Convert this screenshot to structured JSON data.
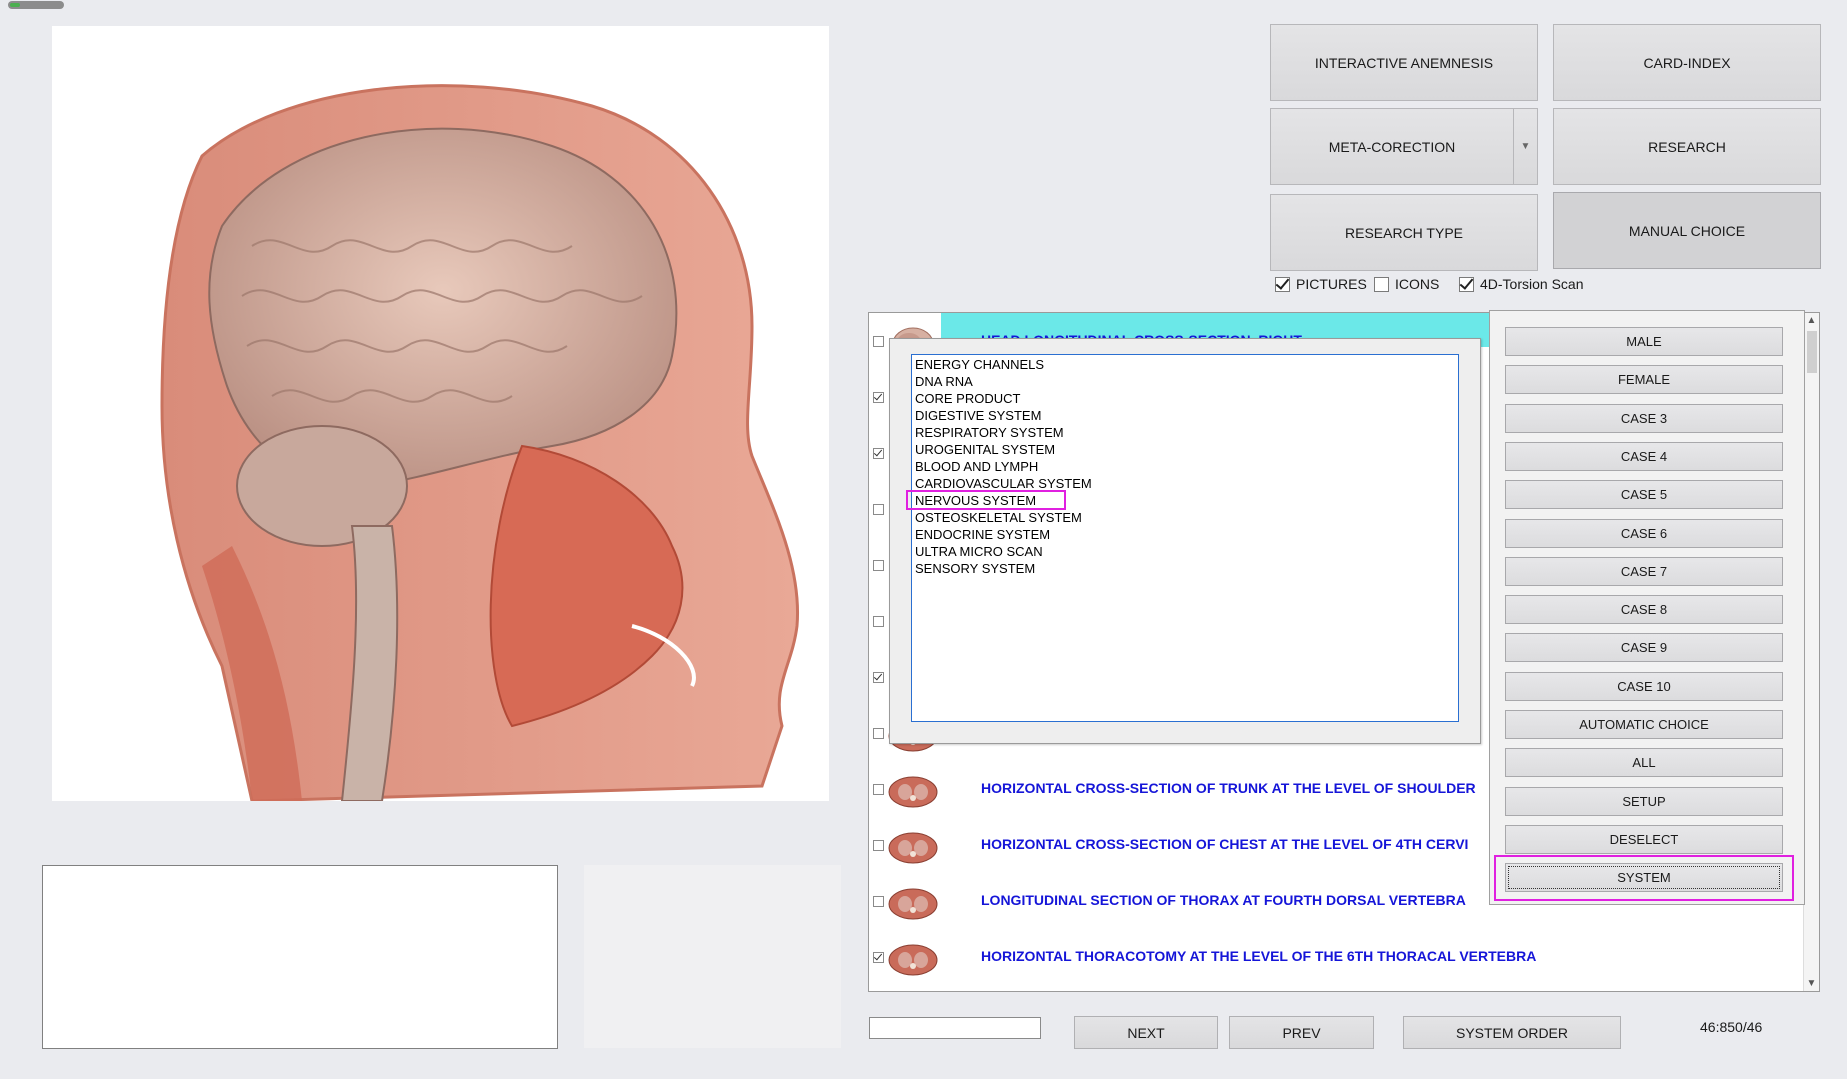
{
  "progress": {
    "level": 0.2
  },
  "buttons": {
    "interactive_anemnesis": "INTERACTIVE ANEMNESIS",
    "card_index": "CARD-INDEX",
    "meta_corection": "META-CORECTION",
    "research": "RESEARCH",
    "research_type": "RESEARCH TYPE",
    "manual_choice": "MANUAL CHOICE"
  },
  "options": {
    "pictures": {
      "label": "PICTURES",
      "checked": true
    },
    "icons": {
      "label": "ICONS",
      "checked": false
    },
    "torsion": {
      "label": "4D-Torsion Scan",
      "checked": true
    }
  },
  "list": {
    "rows": [
      {
        "text": "HEAD LONGITUDINAL CROSS-SECTION. RIGHT",
        "checked": false,
        "thumb": "head-thumb"
      },
      {
        "text": "",
        "checked": true,
        "thumb": "none"
      },
      {
        "text": "",
        "checked": true,
        "thumb": "none"
      },
      {
        "text": "",
        "checked": false,
        "thumb": "none"
      },
      {
        "text": "",
        "checked": false,
        "thumb": "none"
      },
      {
        "text": "",
        "checked": false,
        "thumb": "none"
      },
      {
        "text": "",
        "checked": true,
        "thumb": "none"
      },
      {
        "text": "",
        "checked": false,
        "thumb": "section-thumb"
      },
      {
        "text": "HORIZONTAL CROSS-SECTION OF TRUNK AT THE LEVEL OF SHOULDER",
        "checked": false,
        "thumb": "section-thumb"
      },
      {
        "text": "HORIZONTAL CROSS-SECTION OF CHEST AT THE LEVEL OF 4TH CERVI",
        "checked": false,
        "thumb": "section-thumb"
      },
      {
        "text": "LONGITUDINAL SECTION OF THORAX AT FOURTH DORSAL VERTEBRA",
        "checked": false,
        "thumb": "section-thumb"
      },
      {
        "text": "HORIZONTAL THORACOTOMY AT THE LEVEL OF THE 6TH THORACAL VERTEBRA",
        "checked": true,
        "thumb": "section-thumb"
      }
    ]
  },
  "system_popup": {
    "items": [
      "ENERGY CHANNELS",
      "DNA RNA",
      "CORE PRODUCT",
      "DIGESTIVE SYSTEM",
      "RESPIRATORY SYSTEM",
      "UROGENITAL SYSTEM",
      "BLOOD AND LYMPH",
      "CARDIOVASCULAR SYSTEM",
      "NERVOUS SYSTEM",
      "OSTEOSKELETAL SYSTEM",
      "ENDOCRINE SYSTEM",
      "ULTRA MICRO SCAN",
      "SENSORY SYSTEM"
    ],
    "highlighted": "NERVOUS SYSTEM"
  },
  "case_panel": {
    "buttons": [
      "MALE",
      "FEMALE",
      "CASE 3",
      "CASE 4",
      "CASE 5",
      "CASE 6",
      "CASE 7",
      "CASE 8",
      "CASE 9",
      "CASE 10",
      "AUTOMATIC CHOICE",
      "ALL",
      "SETUP",
      "DESELECT",
      "SYSTEM"
    ],
    "highlighted": "SYSTEM"
  },
  "bottom": {
    "page_input_value": "",
    "next": "NEXT",
    "prev": "PREV",
    "system_order": "SYSTEM ORDER",
    "counter": "46:850/46"
  },
  "colors": {
    "accent_highlight": "#e020e0",
    "list_text": "#1515d8",
    "selected_row": "#6be8e8"
  }
}
